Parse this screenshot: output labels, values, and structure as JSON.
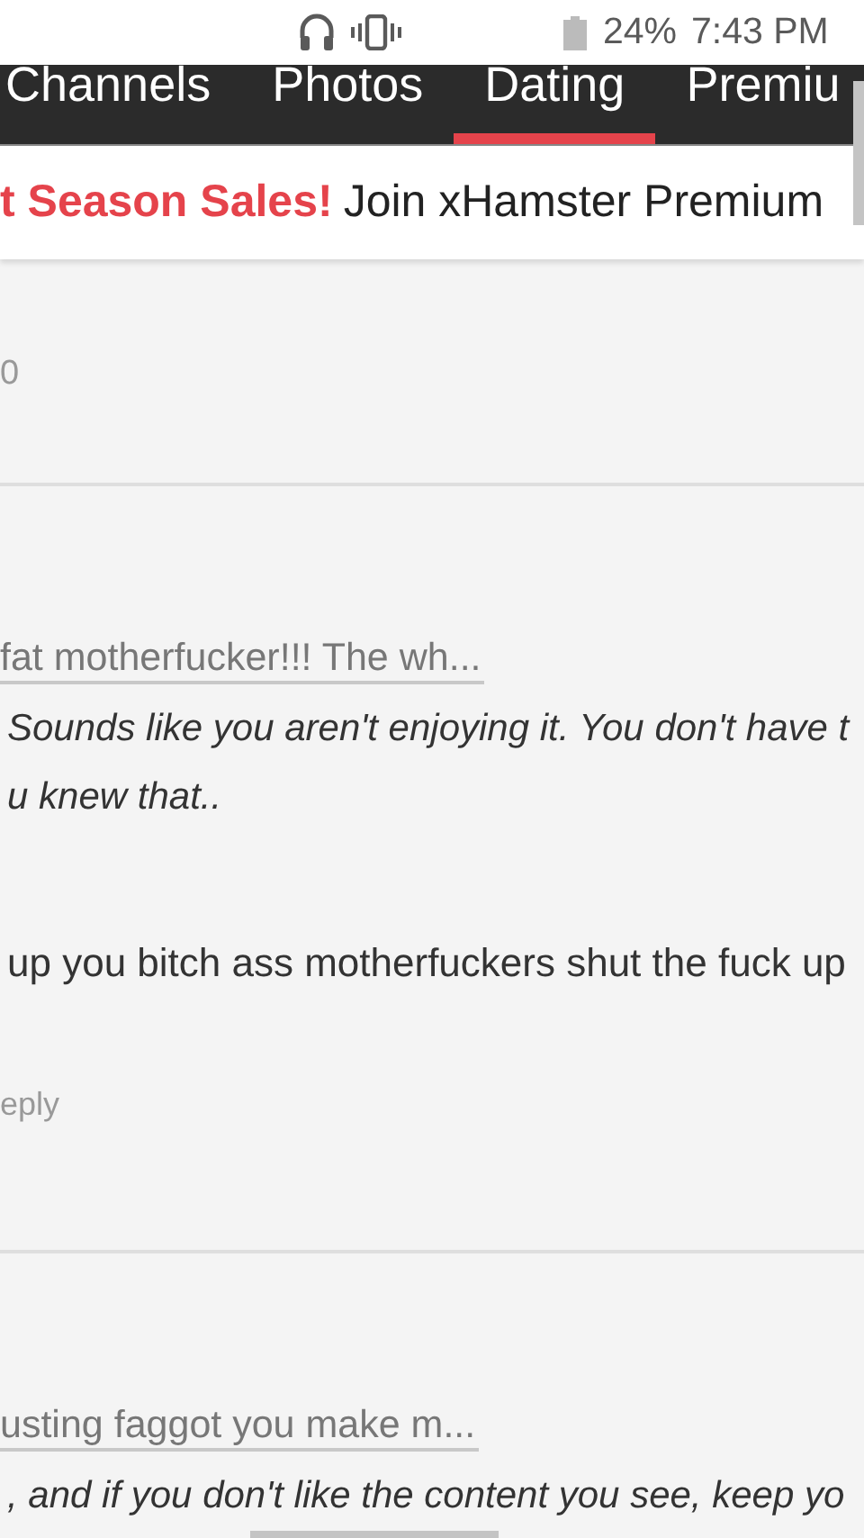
{
  "status_bar": {
    "battery": "24%",
    "time": "7:43 PM"
  },
  "tabs": [
    {
      "label": "Channels",
      "selected": false
    },
    {
      "label": "Photos",
      "selected": false
    },
    {
      "label": "Dating",
      "selected": true
    },
    {
      "label": "Premiu",
      "selected": false
    }
  ],
  "promo": {
    "highlight": "t Season Sales!",
    "text": "Join xHamster Premium"
  },
  "feed": [
    {
      "kind": "meta",
      "text": "0"
    },
    {
      "kind": "divider"
    },
    {
      "kind": "quote",
      "text": "fat motherfucker!!! The wh..."
    },
    {
      "kind": "reply",
      "lines": [
        "Sounds like you aren't enjoying it. You don't have t",
        "u knew that.."
      ]
    },
    {
      "kind": "body",
      "text": "up you bitch ass motherfuckers shut the fuck up"
    },
    {
      "kind": "action",
      "text": "eply"
    },
    {
      "kind": "divider"
    },
    {
      "kind": "quote",
      "text": "usting faggot you make m..."
    },
    {
      "kind": "reply",
      "lines": [
        ", and if you don't like the content you see, keep yo"
      ]
    }
  ]
}
